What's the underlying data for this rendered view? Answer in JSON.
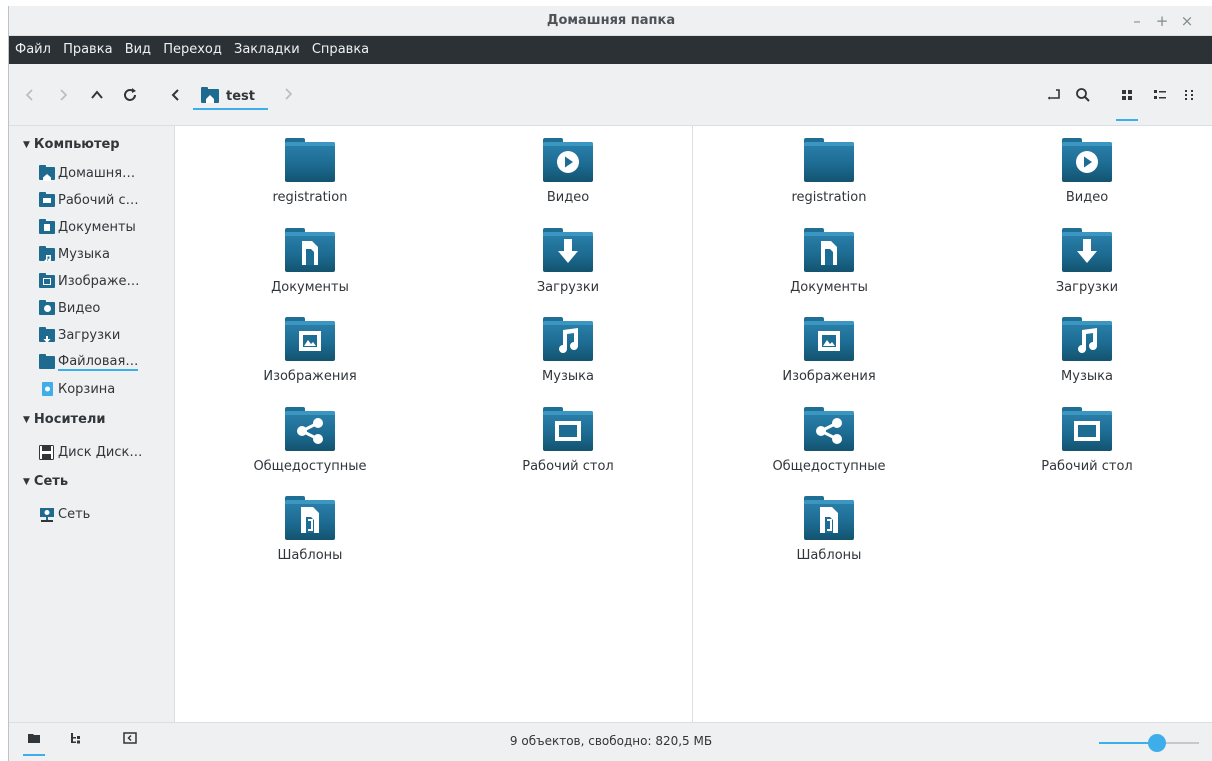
{
  "window": {
    "title": "Домашняя папка",
    "controls": {
      "minimize": "–",
      "maximize": "+",
      "close": "×"
    }
  },
  "menubar": {
    "items": [
      "Файл",
      "Правка",
      "Вид",
      "Переход",
      "Закладки",
      "Справка"
    ]
  },
  "toolbar": {
    "back": "‹",
    "forward": "›",
    "up": "^",
    "reload": "C",
    "breadcrumb_back": "‹",
    "breadcrumb_home": "test",
    "breadcrumb_next": "›",
    "view_active": "icons"
  },
  "sidebar": {
    "sections": [
      {
        "label": "Компьютер",
        "items": [
          {
            "label": "Домашня…",
            "icon": "home-folder-icon"
          },
          {
            "label": "Рабочий с…",
            "icon": "desktop-folder-icon"
          },
          {
            "label": "Документы",
            "icon": "documents-folder-icon"
          },
          {
            "label": "Музыка",
            "icon": "music-folder-icon"
          },
          {
            "label": "Изображе…",
            "icon": "pictures-folder-icon"
          },
          {
            "label": "Видео",
            "icon": "videos-folder-icon"
          },
          {
            "label": "Загрузки",
            "icon": "downloads-folder-icon"
          },
          {
            "label": "Файловая…",
            "icon": "filesystem-folder-icon"
          },
          {
            "label": "Корзина",
            "icon": "trash-icon"
          }
        ]
      },
      {
        "label": "Носители",
        "items": [
          {
            "label": "Диск Диск…",
            "icon": "disk-icon"
          }
        ]
      },
      {
        "label": "Сеть",
        "items": [
          {
            "label": "Сеть",
            "icon": "network-icon"
          }
        ]
      }
    ]
  },
  "files": [
    {
      "name": "registration",
      "icon": "folder-icon"
    },
    {
      "name": "Видео",
      "icon": "videos-folder-icon"
    },
    {
      "name": "Документы",
      "icon": "documents-folder-icon"
    },
    {
      "name": "Загрузки",
      "icon": "downloads-folder-icon"
    },
    {
      "name": "Изображения",
      "icon": "pictures-folder-icon"
    },
    {
      "name": "Музыка",
      "icon": "music-folder-icon"
    },
    {
      "name": "Общедоступные",
      "icon": "shared-folder-icon"
    },
    {
      "name": "Рабочий стол",
      "icon": "desktop-folder-icon"
    },
    {
      "name": "Шаблоны",
      "icon": "templates-folder-icon"
    }
  ],
  "statusbar": {
    "text": "9 объектов, свободно: 820,5 МБ",
    "zoom_fraction": 0.58
  },
  "colors": {
    "accent": "#3daee9",
    "folder": "#1d6c93",
    "menubar": "#2c3135"
  }
}
